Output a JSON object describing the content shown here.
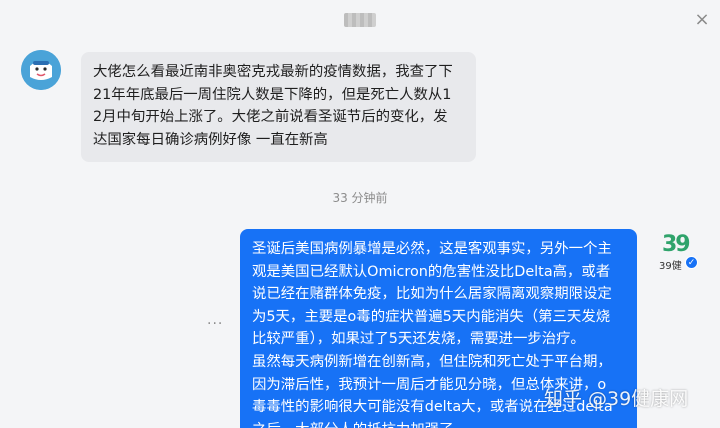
{
  "colors": {
    "background": "#f4f5f7",
    "bubble_left": "#e8e9ec",
    "bubble_right": "#1772f6",
    "logo_green": "#2fa36b"
  },
  "header": {
    "close_glyph": "×"
  },
  "messages": {
    "incoming": {
      "text": "大佬怎么看最近南非奥密克戎最新的疫情数据，我查了下\n21年年底最后一周住院人数是下降的，但是死亡人数从1\n2月中旬开始上涨了。大佬之前说看圣诞节后的变化，发\n达国家每日确诊病例好像 一直在新高"
    },
    "timestamp": "33 分钟前",
    "outgoing": {
      "text": "圣诞后美国病例暴增是必然，这是客观事实，另外一个主\n观是美国已经默认Omicron的危害性没比Delta高，或者\n说已经在赌群体免疫，比如为什么居家隔离观察期限设定\n为5天，主要是o毒的症状普遍5天内能消失（第三天发烧\n比较严重），如果过了5天还发烧，需要进一步治疗。\n虽然每天病例新增在创新高，但住院和死亡处于平台期，\n因为滞后性，我预计一周后才能见分晓，但总体来讲，o\n毒毒性的影响很大可能没有delta大，或者说在经过delta\n之后，大部分人的抵抗力加强了。"
    },
    "more_glyph": "···"
  },
  "right_avatar": {
    "logo_number": "39",
    "logo_label": "39健",
    "verified_glyph": "✓"
  },
  "watermark": "知乎 @39健康网"
}
